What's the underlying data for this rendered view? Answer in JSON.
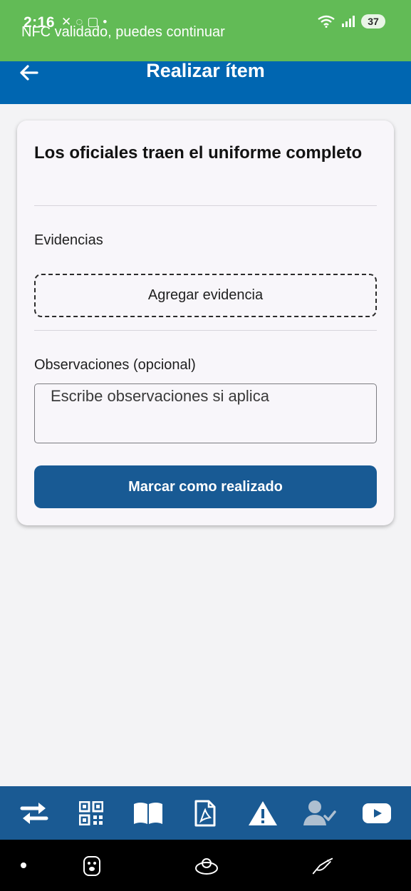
{
  "status_bar": {
    "time": "2:16",
    "battery": "37"
  },
  "toast": {
    "message": "NFC validado, puedes continuar"
  },
  "app_bar": {
    "title": "Realizar ítem"
  },
  "card": {
    "title": "Los oficiales traen el uniforme completo",
    "evidence_label": "Evidencias",
    "evidence_button": "Agregar evidencia",
    "observations_label": "Observaciones (opcional)",
    "observations_placeholder": "Escribe observaciones si aplica",
    "observations_value": "",
    "submit_button": "Marcar como realizado"
  },
  "bottom_nav": {
    "items": [
      {
        "icon": "swap-arrows-icon"
      },
      {
        "icon": "qr-code-icon"
      },
      {
        "icon": "book-icon"
      },
      {
        "icon": "pdf-file-icon"
      },
      {
        "icon": "warning-icon"
      },
      {
        "icon": "user-check-icon"
      },
      {
        "icon": "youtube-icon"
      }
    ]
  },
  "colors": {
    "toast_green": "#62bb56",
    "app_bar_blue": "#0066b1",
    "primary_button": "#185a94",
    "bottom_nav": "#1a5a93"
  }
}
